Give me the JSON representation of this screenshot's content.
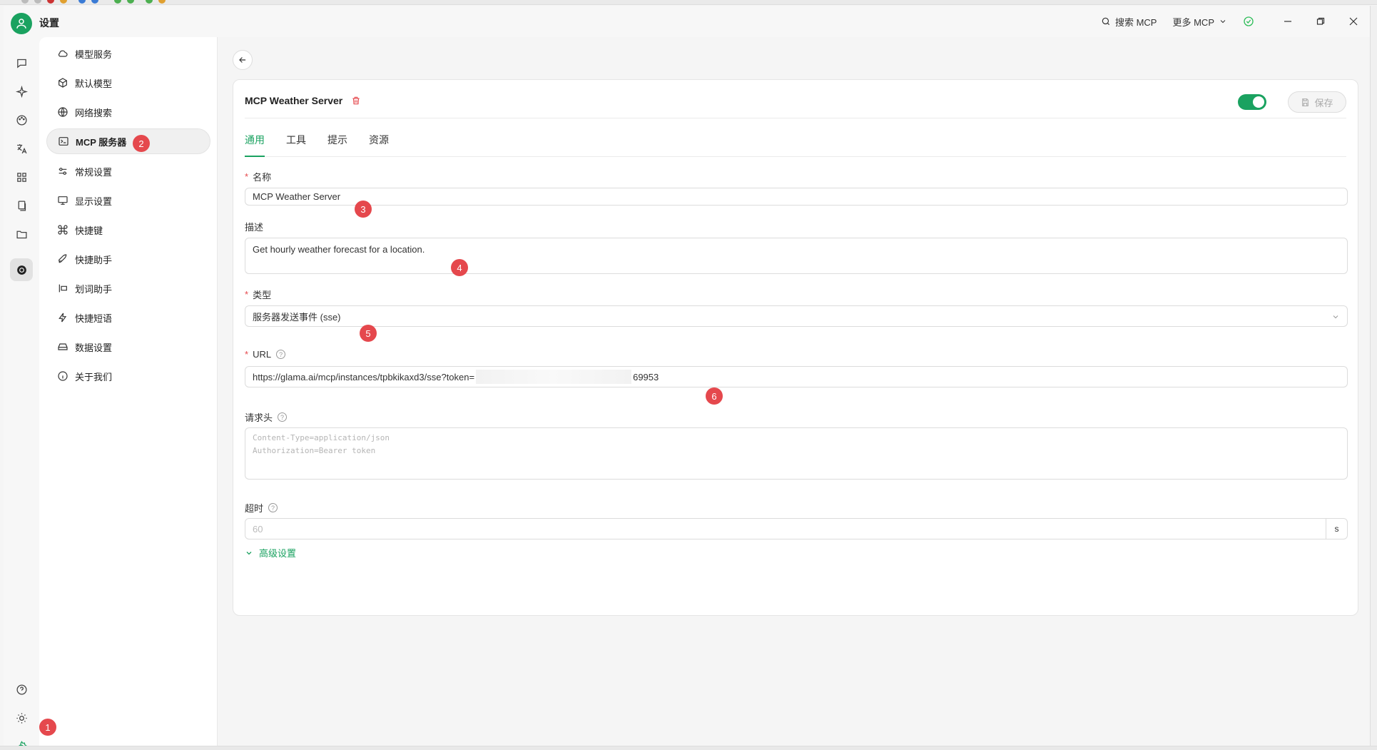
{
  "window": {
    "title": "设置",
    "search_mcp_label": "搜索 MCP",
    "more_mcp_label": "更多 MCP"
  },
  "rail": {
    "icons": [
      "chat-icon",
      "sparkle-icon",
      "palette-icon",
      "translate-icon",
      "apps-icon",
      "files-copy-icon",
      "folder-icon",
      "openai-icon"
    ],
    "bottom_icons": [
      "help-icon",
      "sun-icon",
      "settings-gear-icon"
    ]
  },
  "menu": {
    "items": [
      {
        "label": "模型服务",
        "icon": "cloud-icon"
      },
      {
        "label": "默认模型",
        "icon": "cube-icon"
      },
      {
        "label": "网络搜索",
        "icon": "globe-icon"
      },
      {
        "label": "MCP 服务器",
        "icon": "terminal-icon"
      },
      {
        "label": "常规设置",
        "icon": "sliders-icon"
      },
      {
        "label": "显示设置",
        "icon": "monitor-icon"
      },
      {
        "label": "快捷键",
        "icon": "command-icon"
      },
      {
        "label": "快捷助手",
        "icon": "rocket-icon"
      },
      {
        "label": "划词助手",
        "icon": "text-select-icon"
      },
      {
        "label": "快捷短语",
        "icon": "zap-icon"
      },
      {
        "label": "数据设置",
        "icon": "hard-drive-icon"
      },
      {
        "label": "关于我们",
        "icon": "info-icon"
      }
    ],
    "active_index": 3
  },
  "server": {
    "title": "MCP Weather Server",
    "enabled": true,
    "save_label": "保存",
    "tabs": [
      "通用",
      "工具",
      "提示",
      "资源"
    ],
    "active_tab": 0,
    "fields": {
      "name_label": "名称",
      "name_value": "MCP Weather Server",
      "desc_label": "描述",
      "desc_value": "Get hourly weather forecast for a location.",
      "type_label": "类型",
      "type_value": "服务器发送事件 (sse)",
      "url_label": "URL",
      "url_prefix": "https://glama.ai/mcp/instances/tpbkikaxd3/sse?token=",
      "url_suffix": "69953",
      "headers_label": "请求头",
      "headers_placeholder_1": "Content-Type=application/json",
      "headers_placeholder_2": "Authorization=Bearer token",
      "timeout_label": "超时",
      "timeout_placeholder": "60",
      "timeout_unit": "s"
    },
    "advanced_label": "高级设置"
  },
  "annotations": [
    "1",
    "2",
    "3",
    "4",
    "5",
    "6"
  ],
  "colors": {
    "accent": "#1aa260",
    "danger": "#e5484d"
  }
}
